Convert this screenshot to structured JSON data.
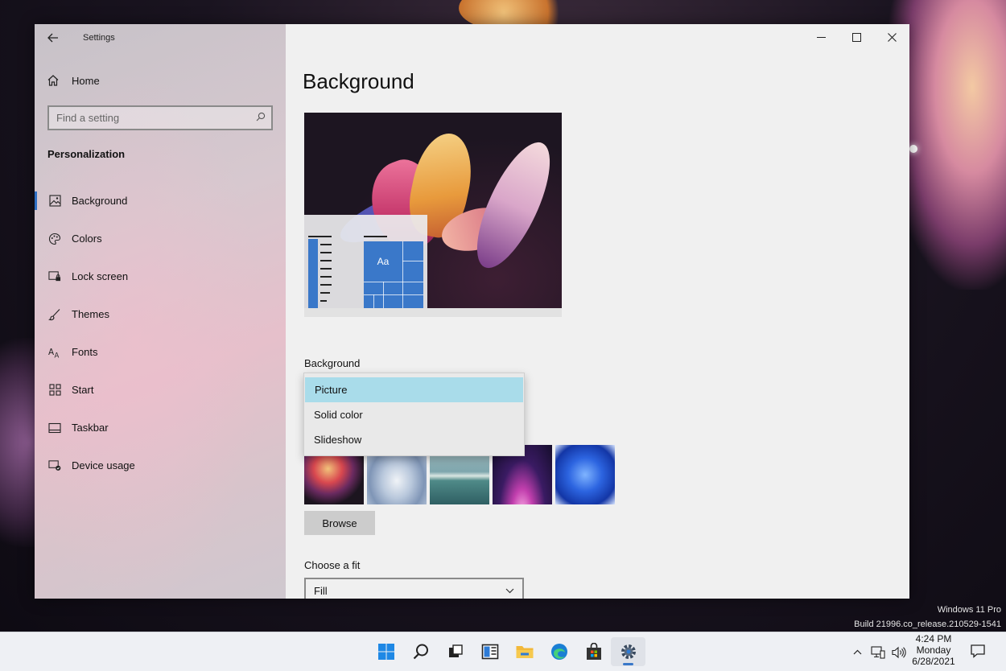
{
  "window": {
    "app_title": "Settings",
    "home_label": "Home",
    "search_placeholder": "Find a setting",
    "section_title": "Personalization"
  },
  "sidebar": {
    "items": [
      {
        "label": "Background",
        "icon": "picture-icon",
        "active": true
      },
      {
        "label": "Colors",
        "icon": "palette-icon"
      },
      {
        "label": "Lock screen",
        "icon": "lock-screen-icon"
      },
      {
        "label": "Themes",
        "icon": "brush-icon"
      },
      {
        "label": "Fonts",
        "icon": "font-icon"
      },
      {
        "label": "Start",
        "icon": "start-grid-icon"
      },
      {
        "label": "Taskbar",
        "icon": "taskbar-icon"
      },
      {
        "label": "Device usage",
        "icon": "device-usage-icon"
      }
    ]
  },
  "main": {
    "page_title": "Background",
    "preview_tile_text": "Aa",
    "background_label": "Background",
    "background_options": [
      "Picture",
      "Solid color",
      "Slideshow"
    ],
    "background_selected": "Picture",
    "thumbnails": [
      "bloom",
      "white-swirl",
      "lake",
      "purple-glow",
      "blue-bloom"
    ],
    "browse_label": "Browse",
    "fit_label": "Choose a fit",
    "fit_value": "Fill"
  },
  "watermark": {
    "edition": "Windows 11 Pro",
    "build": "Build 21996.co_release.210529-1541"
  },
  "taskbar": {
    "apps": [
      "start",
      "search",
      "task-view",
      "widgets",
      "file-explorer",
      "edge",
      "store",
      "settings"
    ],
    "active_app": "settings",
    "clock_time": "4:24 PM",
    "clock_day": "Monday",
    "clock_date": "6/28/2021"
  },
  "colors": {
    "accent": "#3a78c9",
    "selected_option": "#a9dcea"
  }
}
